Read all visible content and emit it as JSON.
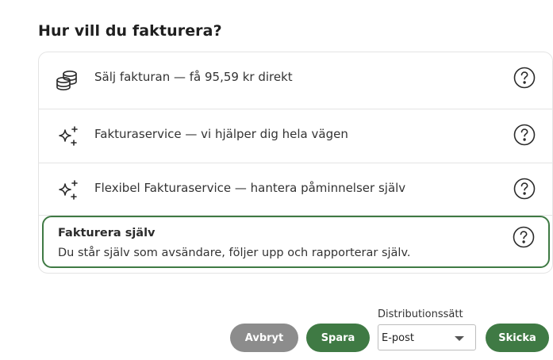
{
  "heading": "Hur vill du fakturera?",
  "options": [
    {
      "label": "Sälj fakturan — få 95,59 kr direkt",
      "icon": "coins-stack-icon"
    },
    {
      "label": "Fakturaservice — vi hjälper dig hela vägen",
      "icon": "sparkle-icon"
    },
    {
      "label": "Flexibel Fakturaservice — hantera påminnelser själv",
      "icon": "sparkle-icon"
    }
  ],
  "selected_option": {
    "title": "Fakturera själv",
    "description": "Du står själv som avsändare, följer upp och rapporterar själv."
  },
  "help_icon": "question-circle-icon",
  "footer": {
    "cancel_label": "Avbryt",
    "save_label": "Spara",
    "distribution_label": "Distributionssätt",
    "distribution_value": "E-post",
    "send_label": "Skicka"
  },
  "colors": {
    "accent": "#3f7a44",
    "cancel": "#8c8c8c",
    "border": "#e4e4e4"
  }
}
